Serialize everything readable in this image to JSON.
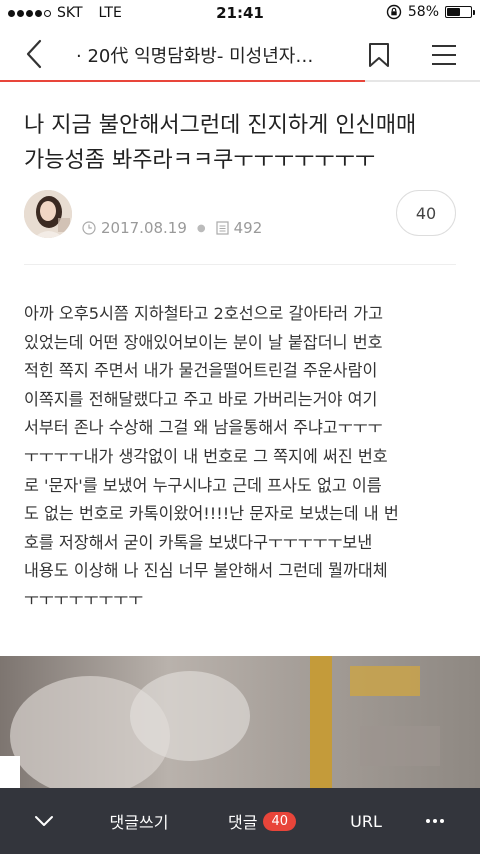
{
  "status_bar": {
    "carrier": "SKT",
    "network": "LTE",
    "time": "21:41",
    "battery_text": "58%",
    "battery_level": 0.58,
    "signal_bars_filled": 4,
    "signal_bars_total": 5
  },
  "nav": {
    "title": "· 20代 익명담화방- 미성년자…",
    "back_icon": "chevron-left-icon",
    "bookmark_icon": "bookmark-icon",
    "menu_icon": "hamburger-menu-icon",
    "read_progress": 0.76,
    "accent_color": "#e8453a"
  },
  "post": {
    "title_lines": [
      "나 지금 불안해서그런데 진지하게 인신매매",
      "가능성좀 봐주라ㅋㅋ쿠ㅜㅜㅜㅜㅜㅜㅜ"
    ],
    "date": "2017.08.19",
    "views": "492",
    "comment_count": "40",
    "body_lines": [
      "아까 오후5시쯤 지하철타고 2호선으로 갈아타러 가고",
      "있었는데 어떤 장애있어보이는 분이 날 붙잡더니 번호",
      "적힌 쪽지 주면서 내가 물건을떨어트린걸 주운사람이",
      "이쪽지를 전해달랬다고 주고 바로 가버리는거야 여기",
      "서부터 존나 수상해 그걸 왜 남을통해서 주냐고ㅜㅜㅜ",
      "ㅜㅜㅜㅜ내가 생각없이 내 번호로 그 쪽지에 써진 번호",
      "로 '문자'를 보냈어 누구시냐고 근데 프사도 없고 이름",
      "도 없는 번호로 카톡이왔어!!!!난 문자로 보냈는데 내 번",
      "호를 저장해서 굳이 카톡을 보냈다구ㅜㅜㅜㅜㅜ보낸",
      "내용도 이상해 나 진심 너무 불안해서 그런데 뭘까대체",
      "ㅜㅜㅜㅜㅜㅜㅜㅜ"
    ]
  },
  "toolbar": {
    "collapse_icon": "chevron-down-icon",
    "write_comment": "댓글쓰기",
    "comments_label": "댓글",
    "comments_badge": "40",
    "url_label": "URL",
    "more_icon": "more-dots-icon"
  }
}
